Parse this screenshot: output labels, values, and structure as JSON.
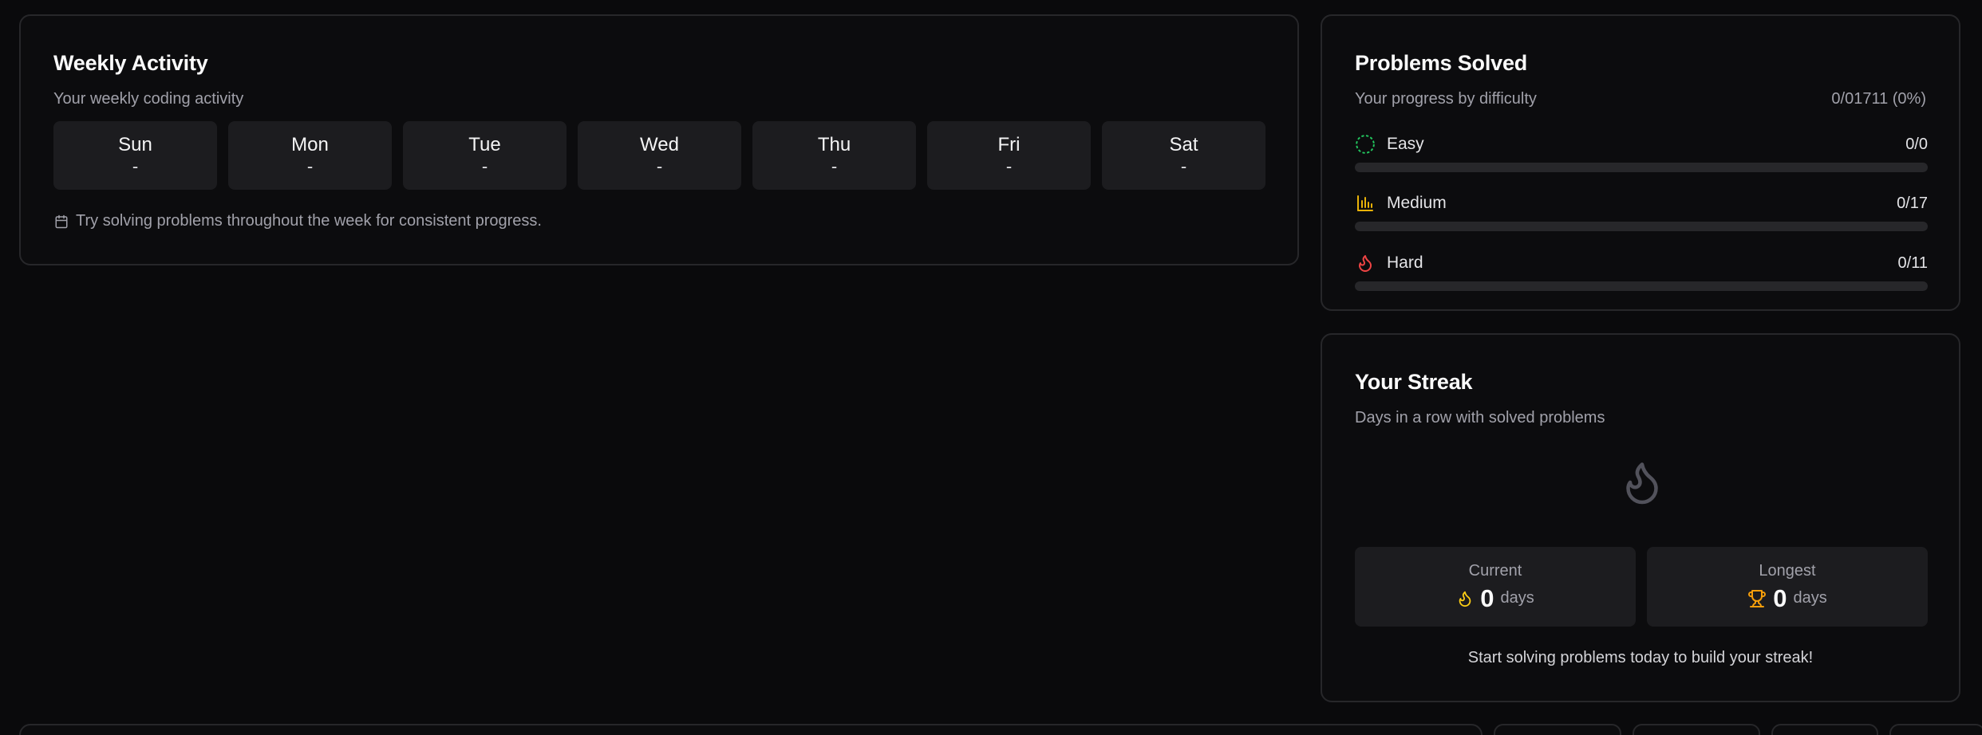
{
  "weekly": {
    "title": "Weekly Activity",
    "subtitle": "Your weekly coding activity",
    "days": [
      {
        "name": "Sun",
        "value": "-"
      },
      {
        "name": "Mon",
        "value": "-"
      },
      {
        "name": "Tue",
        "value": "-"
      },
      {
        "name": "Wed",
        "value": "-"
      },
      {
        "name": "Thu",
        "value": "-"
      },
      {
        "name": "Fri",
        "value": "-"
      },
      {
        "name": "Sat",
        "value": "-"
      }
    ],
    "tip": "Try solving problems throughout the week for consistent progress.",
    "tip_icon": "calendar-icon"
  },
  "solved": {
    "title": "Problems Solved",
    "subtitle": "Your progress by difficulty",
    "total": "0/01711 (0%)",
    "rows": [
      {
        "label": "Easy",
        "count": "0/0",
        "progress": 0,
        "icon": "dashed-circle-icon",
        "color": "#22c55e"
      },
      {
        "label": "Medium",
        "count": "0/17",
        "progress": 0,
        "icon": "bar-chart-icon",
        "color": "#eab308"
      },
      {
        "label": "Hard",
        "count": "0/11",
        "progress": 0,
        "icon": "flame-icon",
        "color": "#ef4444"
      }
    ]
  },
  "streak": {
    "title": "Your Streak",
    "subtitle": "Days in a row with solved problems",
    "big_icon": "flame-icon",
    "current": {
      "label": "Current",
      "value": "0",
      "unit": "days",
      "icon": "flame-icon",
      "color": "#facc15"
    },
    "longest": {
      "label": "Longest",
      "value": "0",
      "unit": "days",
      "icon": "trophy-icon",
      "color": "#f59e0b"
    },
    "footer": "Start solving problems today to build your streak!"
  },
  "colors": {
    "background": "#0a0a0c",
    "card": "#0c0c0e",
    "border": "#27272a",
    "tile": "#1c1c1f",
    "muted_text": "#a1a1aa"
  }
}
